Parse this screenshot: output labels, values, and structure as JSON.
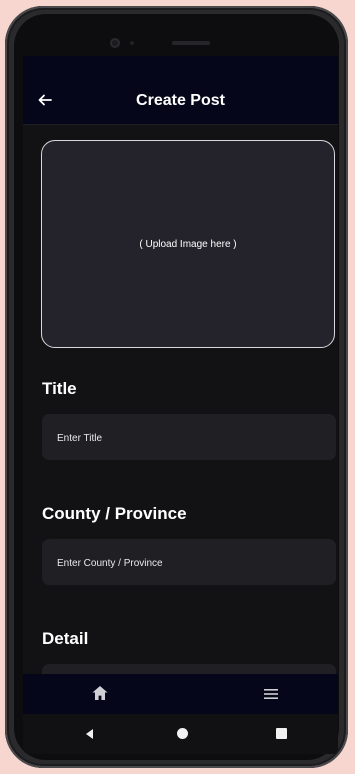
{
  "app_bar": {
    "back_icon": "arrow-left-icon",
    "title": "Create Post"
  },
  "upload": {
    "text": "( Upload Image here )"
  },
  "form": {
    "title_label": "Title",
    "title_placeholder": "Enter Title",
    "county_label": "County / Province",
    "county_placeholder": "Enter County / Province",
    "detail_label": "Detail"
  },
  "bottom_nav": {
    "items": [
      {
        "icon": "home-icon"
      },
      {
        "icon": "menu-icon"
      }
    ]
  },
  "system_nav": {
    "items": [
      {
        "icon": "back-triangle-icon"
      },
      {
        "icon": "home-circle-icon"
      },
      {
        "icon": "recents-square-icon"
      }
    ]
  },
  "colors": {
    "app_bar_bg": "#06061a",
    "screen_bg": "#121214",
    "field_bg": "#1f1f24",
    "upload_bg": "#24232b",
    "text": "#ffffff"
  }
}
